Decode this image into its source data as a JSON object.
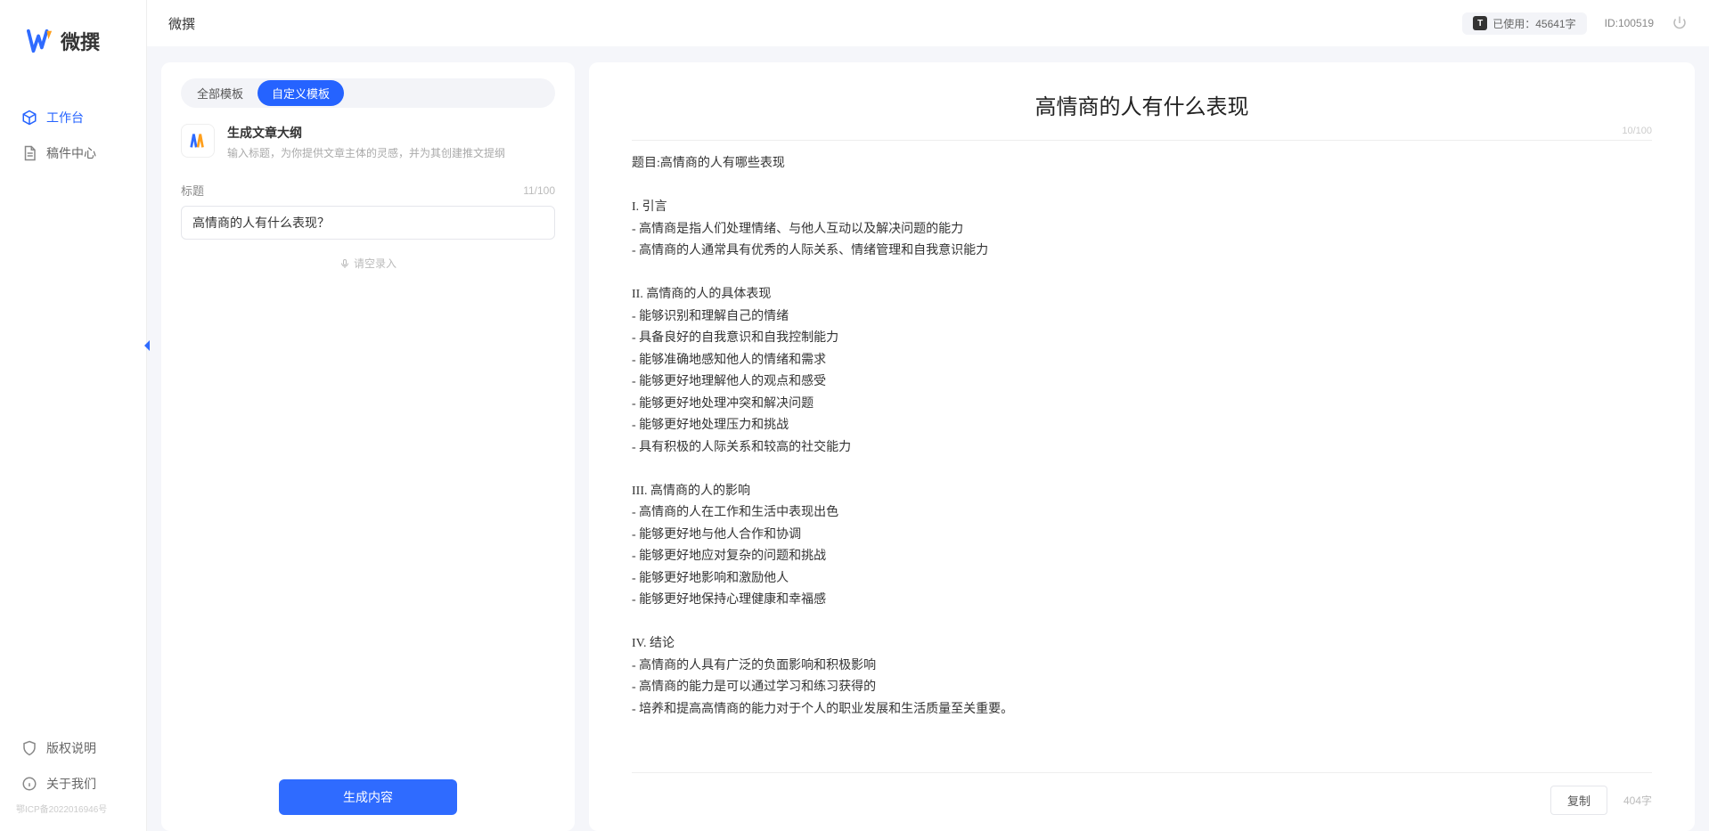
{
  "app": {
    "name": "微撰",
    "topbar_title": "微撰"
  },
  "sidebar": {
    "items": [
      {
        "label": "工作台",
        "icon": "cube-icon",
        "active": true
      },
      {
        "label": "稿件中心",
        "icon": "document-icon",
        "active": false
      }
    ],
    "bottom_items": [
      {
        "label": "版权说明",
        "icon": "shield-icon"
      },
      {
        "label": "关于我们",
        "icon": "info-icon"
      }
    ],
    "footer_text": "鄂ICP备2022016946号"
  },
  "topbar": {
    "usage_badge": "T",
    "usage_text": "已使用：45641字",
    "id_text": "ID:100519"
  },
  "left_panel": {
    "tabs": [
      {
        "label": "全部模板",
        "active": false
      },
      {
        "label": "自定义模板",
        "active": true
      }
    ],
    "template": {
      "title": "生成文章大纲",
      "desc": "输入标题，为你提供文章主体的灵感，并为其创建推文提纲"
    },
    "field_label": "标题",
    "title_counter": "11/100",
    "title_value": "高情商的人有什么表现？",
    "voice_hint": "请空录入",
    "generate_label": "生成内容"
  },
  "right_panel": {
    "heading": "高情商的人有什么表现",
    "top_counter": "10/100",
    "body": "题目:高情商的人有哪些表现\n\nI. 引言\n- 高情商是指人们处理情绪、与他人互动以及解决问题的能力\n- 高情商的人通常具有优秀的人际关系、情绪管理和自我意识能力\n\nII. 高情商的人的具体表现\n- 能够识别和理解自己的情绪\n- 具备良好的自我意识和自我控制能力\n- 能够准确地感知他人的情绪和需求\n- 能够更好地理解他人的观点和感受\n- 能够更好地处理冲突和解决问题\n- 能够更好地处理压力和挑战\n- 具有积极的人际关系和较高的社交能力\n\nIII. 高情商的人的影响\n- 高情商的人在工作和生活中表现出色\n- 能够更好地与他人合作和协调\n- 能够更好地应对复杂的问题和挑战\n- 能够更好地影响和激励他人\n- 能够更好地保持心理健康和幸福感\n\nIV. 结论\n- 高情商的人具有广泛的负面影响和积极影响\n- 高情商的能力是可以通过学习和练习获得的\n- 培养和提高高情商的能力对于个人的职业发展和生活质量至关重要。",
    "copy_label": "复制",
    "char_count": "404字"
  }
}
